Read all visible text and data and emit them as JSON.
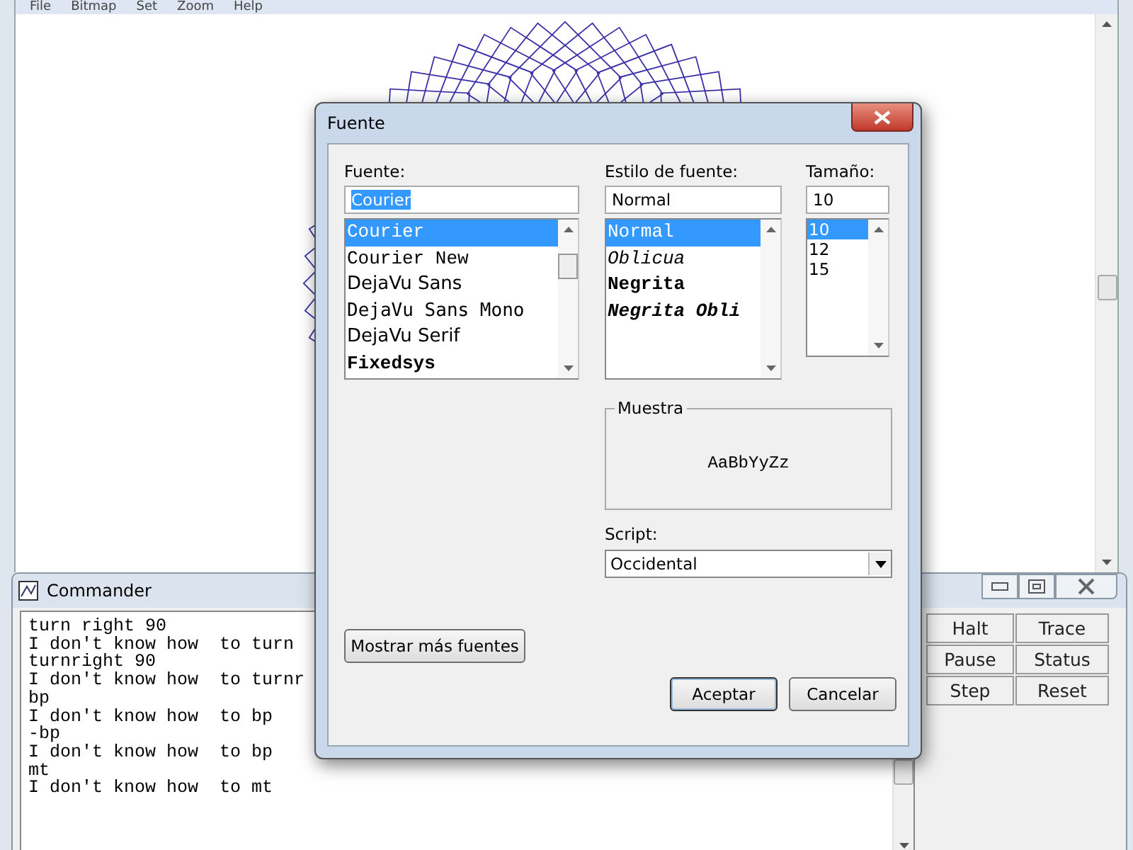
{
  "main_window": {
    "menu": [
      "File",
      "Bitmap",
      "Set",
      "Zoom",
      "Help"
    ]
  },
  "commander": {
    "title": "Commander",
    "output": [
      "turn right 90",
      "I don't know how  to turn",
      "turnright 90",
      "I don't know how  to turnr",
      "bp",
      "I don't know how  to bp",
      "-bp",
      "I don't know how  to bp",
      "mt",
      "I don't know how  to mt"
    ],
    "buttons": [
      "Halt",
      "Trace",
      "Pause",
      "Status",
      "Step",
      "Reset"
    ]
  },
  "font_dialog": {
    "title": "Fuente",
    "font": {
      "label": "Fuente:",
      "value": "Courier",
      "value_highlighted": true,
      "items": [
        {
          "label": "Courier",
          "kind": "mono",
          "selected": true
        },
        {
          "label": "Courier New",
          "kind": "mono",
          "selected": false
        },
        {
          "label": "DejaVu Sans",
          "kind": "sans",
          "selected": false
        },
        {
          "label": "DejaVu Sans Mono",
          "kind": "sans-mono",
          "selected": false
        },
        {
          "label": "DejaVu Serif",
          "kind": "sans",
          "selected": false
        },
        {
          "label": "Fixedsys",
          "kind": "bold-mono",
          "selected": false
        }
      ]
    },
    "style": {
      "label": "Estilo de fuente:",
      "value": "Normal",
      "items": [
        {
          "label": "Normal",
          "kind": "normal",
          "selected": true
        },
        {
          "label": "Oblicua",
          "kind": "italic",
          "selected": false
        },
        {
          "label": "Negrita",
          "kind": "bold",
          "selected": false
        },
        {
          "label": "Negrita Obli",
          "kind": "bold-italic",
          "selected": false
        }
      ]
    },
    "size": {
      "label": "Tamaño:",
      "value": "10",
      "items": [
        {
          "label": "10",
          "selected": true
        },
        {
          "label": "12",
          "selected": false
        },
        {
          "label": "15",
          "selected": false
        }
      ]
    },
    "sample": {
      "label": "Muestra",
      "text": "AaBbYyZz"
    },
    "script": {
      "label": "Script:",
      "value": "Occidental"
    },
    "more_fonts_button": "Mostrar más fuentes",
    "buttons": [
      "Aceptar",
      "Cancelar"
    ]
  }
}
